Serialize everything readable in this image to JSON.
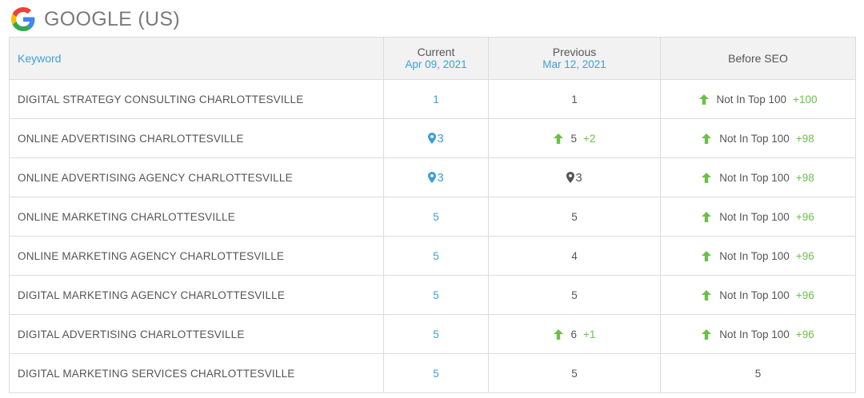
{
  "header": {
    "title": "GOOGLE (US)",
    "logo": "google-g-logo"
  },
  "table": {
    "columns": {
      "keyword": "Keyword",
      "current": "Current",
      "current_date": "Apr 09, 2021",
      "previous": "Previous",
      "previous_date": "Mar 12, 2021",
      "before_seo": "Before SEO"
    },
    "rows": [
      {
        "keyword": "DIGITAL STRATEGY CONSULTING CHARLOTTESVILLE",
        "current": "1",
        "current_pin": false,
        "previous": "1",
        "previous_up": false,
        "previous_pin": false,
        "previous_change": "",
        "before": "Not In Top 100",
        "before_up": true,
        "before_change": "+100"
      },
      {
        "keyword": "ONLINE ADVERTISING CHARLOTTESVILLE",
        "current": "3",
        "current_pin": true,
        "previous": "5",
        "previous_up": true,
        "previous_pin": false,
        "previous_change": "+2",
        "before": "Not In Top 100",
        "before_up": true,
        "before_change": "+98"
      },
      {
        "keyword": "ONLINE ADVERTISING AGENCY CHARLOTTESVILLE",
        "current": "3",
        "current_pin": true,
        "previous": "3",
        "previous_up": false,
        "previous_pin": true,
        "previous_change": "",
        "before": "Not In Top 100",
        "before_up": true,
        "before_change": "+98"
      },
      {
        "keyword": "ONLINE MARKETING CHARLOTTESVILLE",
        "current": "5",
        "current_pin": false,
        "previous": "5",
        "previous_up": false,
        "previous_pin": false,
        "previous_change": "",
        "before": "Not In Top 100",
        "before_up": true,
        "before_change": "+96"
      },
      {
        "keyword": "ONLINE MARKETING AGENCY CHARLOTTESVILLE",
        "current": "5",
        "current_pin": false,
        "previous": "4",
        "previous_up": false,
        "previous_pin": false,
        "previous_change": "",
        "before": "Not In Top 100",
        "before_up": true,
        "before_change": "+96"
      },
      {
        "keyword": "DIGITAL MARKETING AGENCY CHARLOTTESVILLE",
        "current": "5",
        "current_pin": false,
        "previous": "5",
        "previous_up": false,
        "previous_pin": false,
        "previous_change": "",
        "before": "Not In Top 100",
        "before_up": true,
        "before_change": "+96"
      },
      {
        "keyword": "DIGITAL ADVERTISING CHARLOTTESVILLE",
        "current": "5",
        "current_pin": false,
        "previous": "6",
        "previous_up": true,
        "previous_pin": false,
        "previous_change": "+1",
        "before": "Not In Top 100",
        "before_up": true,
        "before_change": "+96"
      },
      {
        "keyword": "DIGITAL MARKETING SERVICES CHARLOTTESVILLE",
        "current": "5",
        "current_pin": false,
        "previous": "5",
        "previous_up": false,
        "previous_pin": false,
        "previous_change": "",
        "before": "5",
        "before_up": false,
        "before_change": ""
      }
    ]
  },
  "colors": {
    "accent_blue": "#3d9fd6",
    "up_green": "#6cc04a",
    "pin_dark": "#555555",
    "header_bg": "#f2f2f2"
  },
  "icons": {
    "up": "arrow-up-icon",
    "pin": "map-pin-icon"
  }
}
